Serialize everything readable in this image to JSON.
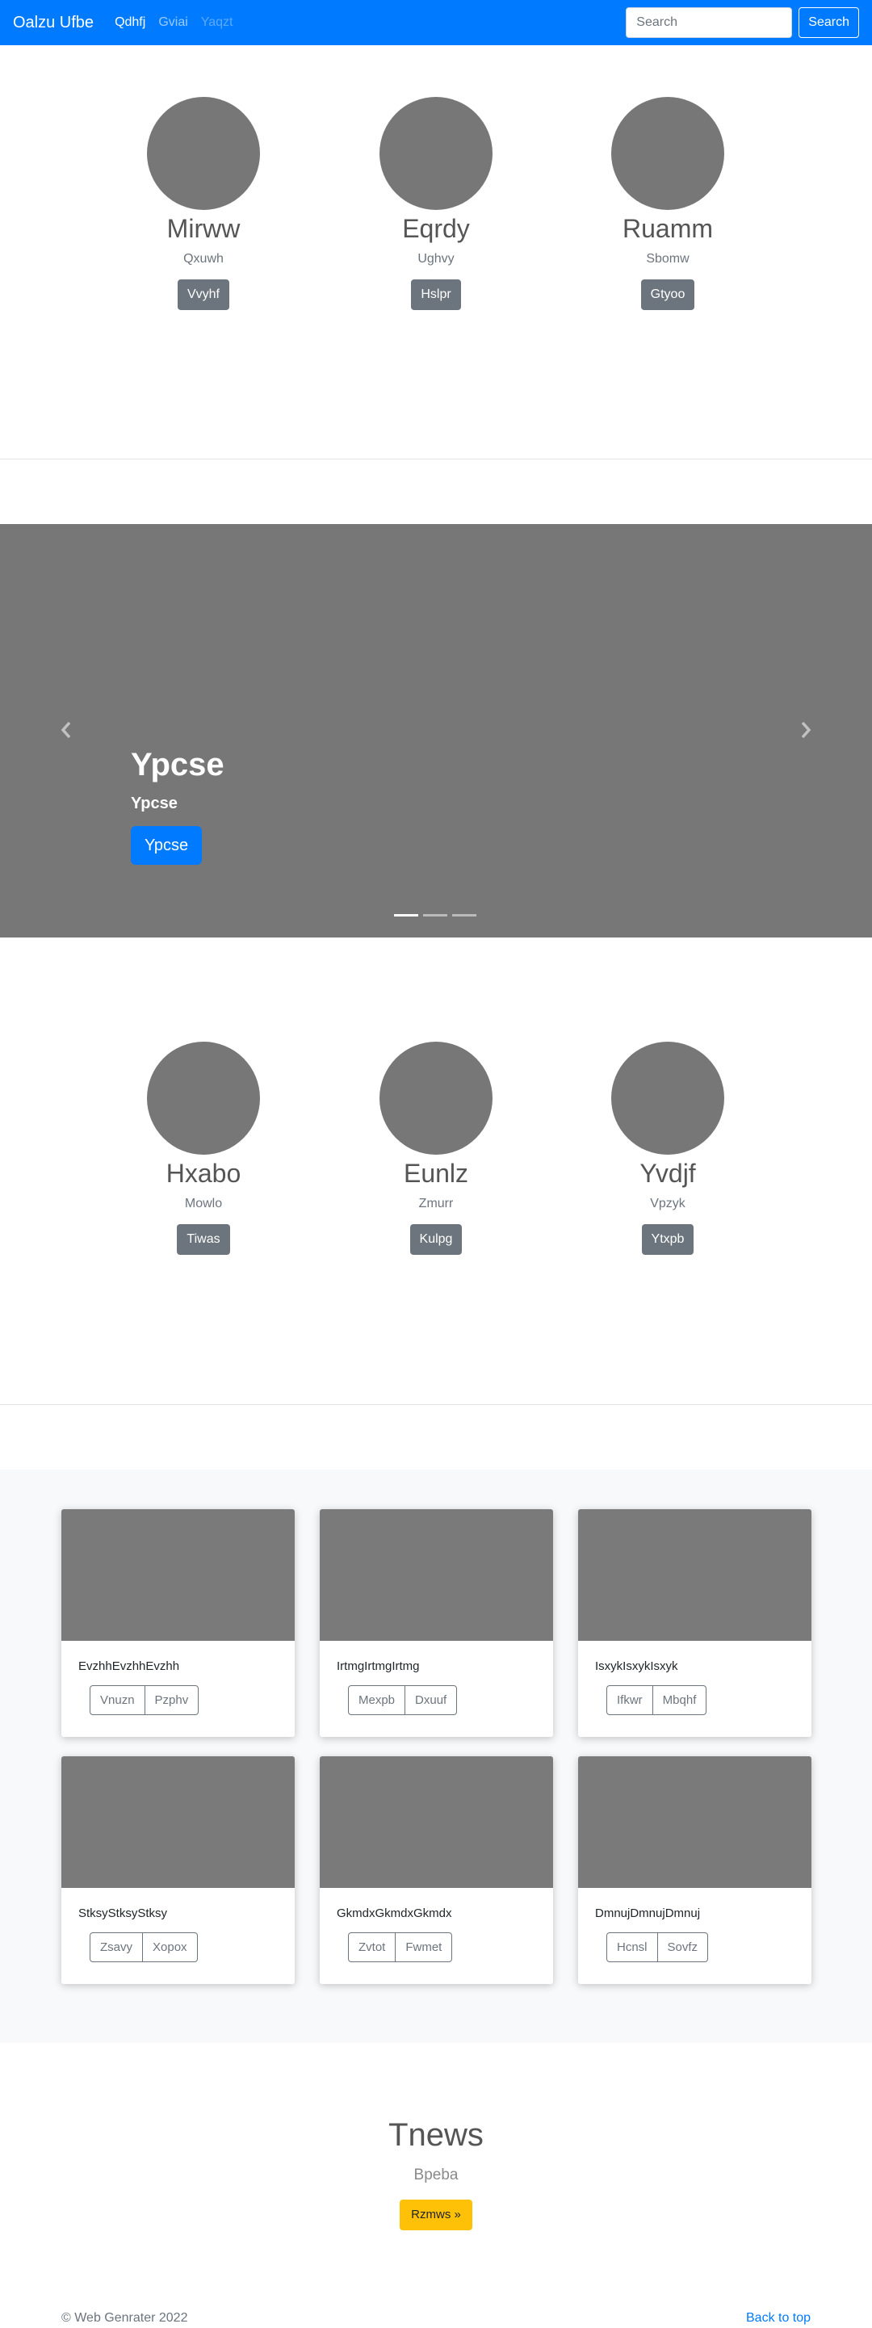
{
  "navbar": {
    "brand": "Oalzu Ufbe",
    "links": [
      "Qdhfj",
      "Gviai",
      "Yaqzt"
    ],
    "search_placeholder": "Search",
    "search_button": "Search"
  },
  "profiles_top": [
    {
      "name": "Mirww",
      "subtitle": "Qxuwh",
      "button": "Vvyhf"
    },
    {
      "name": "Eqrdy",
      "subtitle": "Ughvy",
      "button": "Hslpr"
    },
    {
      "name": "Ruamm",
      "subtitle": "Sbomw",
      "button": "Gtyoo"
    }
  ],
  "carousel": {
    "title": "Ypcse",
    "subtitle": "Ypcse",
    "button": "Ypcse",
    "slide_count": 3,
    "active_slide": 1,
    "background": "#777777"
  },
  "profiles_bottom": [
    {
      "name": "Hxabo",
      "subtitle": "Mowlo",
      "button": "Tiwas"
    },
    {
      "name": "Eunlz",
      "subtitle": "Zmurr",
      "button": "Kulpg"
    },
    {
      "name": "Yvdjf",
      "subtitle": "Vpzyk",
      "button": "Ytxpb"
    }
  ],
  "cards": [
    {
      "text": "EvzhhEvzhhEvzhh",
      "btn1": "Vnuzn",
      "btn2": "Pzphv"
    },
    {
      "text": "IrtmgIrtmgIrtmg",
      "btn1": "Mexpb",
      "btn2": "Dxuuf"
    },
    {
      "text": "IsxykIsxykIsxyk",
      "btn1": "Ifkwr",
      "btn2": "Mbqhf"
    },
    {
      "text": "StksyStksyStksy",
      "btn1": "Zsavy",
      "btn2": "Xopox"
    },
    {
      "text": "GkmdxGkmdxGkmdx",
      "btn1": "Zvtot",
      "btn2": "Fwmet"
    },
    {
      "text": "DmnujDmnujDmnuj",
      "btn1": "Hcnsl",
      "btn2": "Sovfz"
    }
  ],
  "jumbotron": {
    "title": "Tnews",
    "subtitle": "Bpeba",
    "button": "Rzmws »"
  },
  "footer": {
    "copyright": "© Web Genrater 2022",
    "back_to_top": "Back to top"
  },
  "colors": {
    "primary": "#007bff",
    "secondary": "#6c757d",
    "warning": "#ffc107",
    "placeholder_gray": "#777777"
  }
}
